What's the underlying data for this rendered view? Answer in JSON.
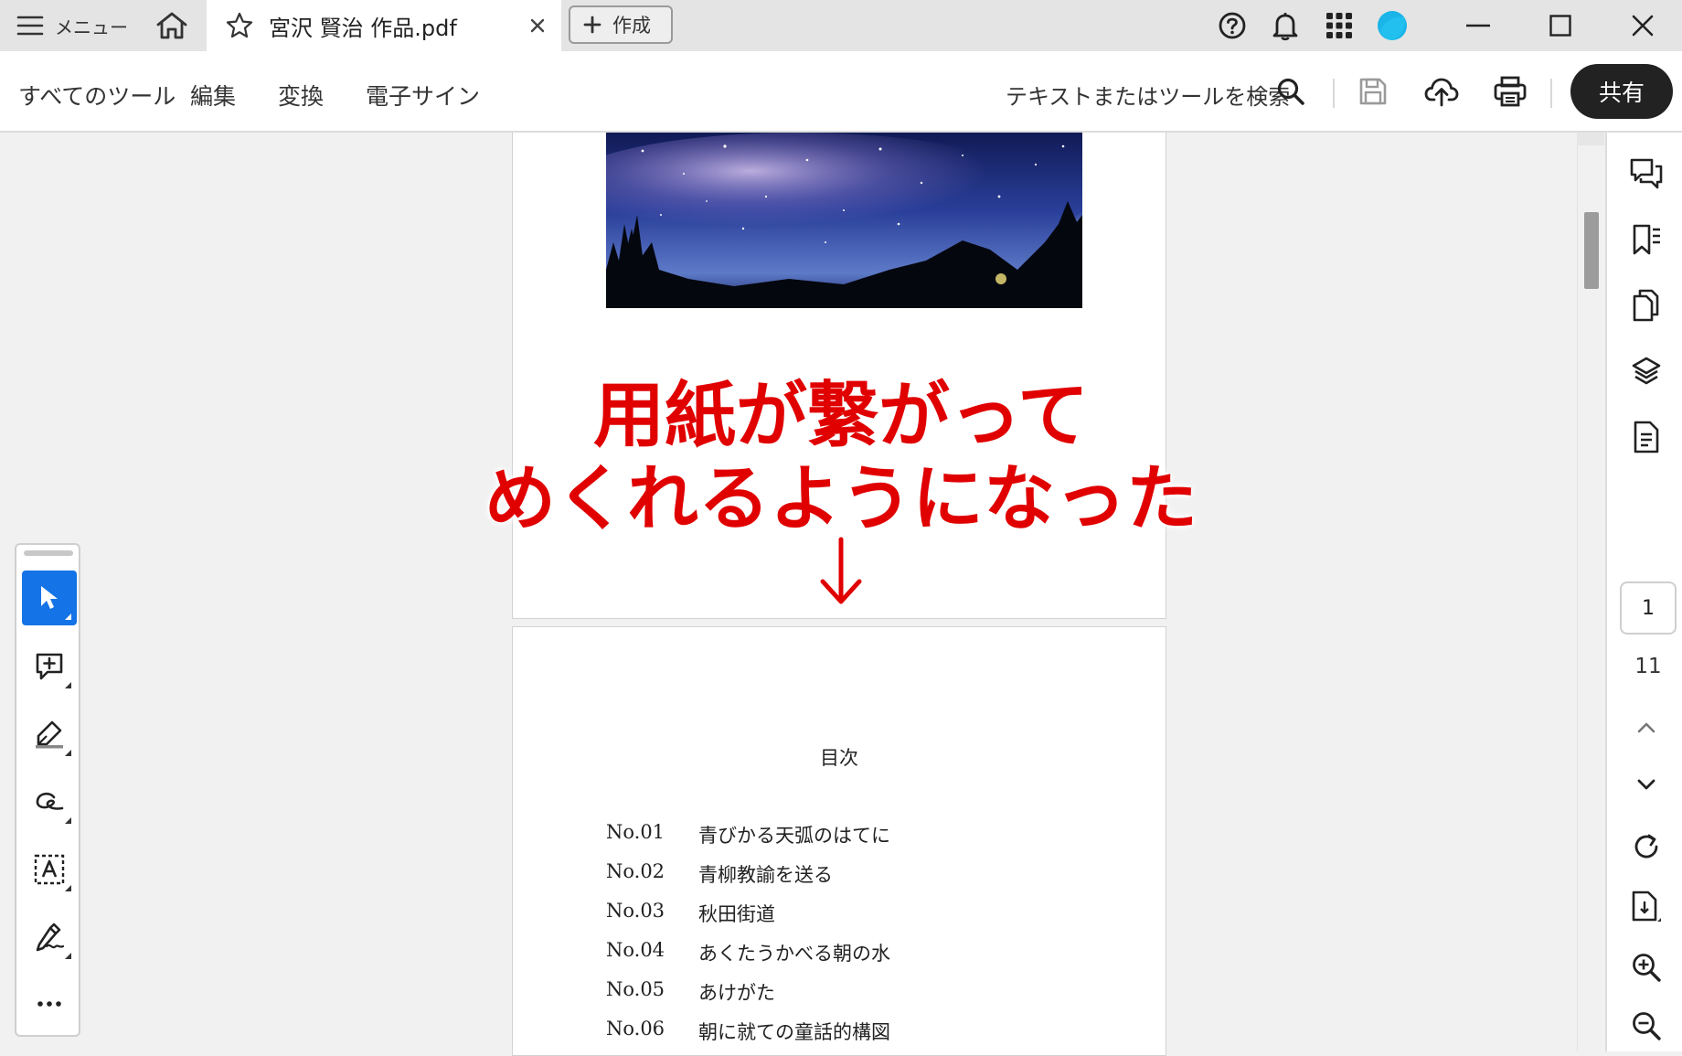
{
  "titlebar": {
    "menu_label": "メニュー",
    "tab_title": "宮沢 賢治 作品.pdf",
    "create_label": "作成",
    "avatar_color": "#1ab4e8"
  },
  "toolbar": {
    "items": [
      "すべてのツール",
      "編集",
      "変換",
      "電子サイン"
    ],
    "search_text": "テキストまたはツールを検索",
    "share_label": "共有"
  },
  "annotation": {
    "line1": "用紙が繋がって",
    "line2": "めくれるようになった",
    "color": "#e00000"
  },
  "toc": {
    "title": "目次",
    "rows": [
      {
        "no": "No.01",
        "title": "青びかる天弧のはてに"
      },
      {
        "no": "No.02",
        "title": "青柳教諭を送る"
      },
      {
        "no": "No.03",
        "title": "秋田街道"
      },
      {
        "no": "No.04",
        "title": "あくたうかべる朝の水"
      },
      {
        "no": "No.05",
        "title": "あけがた"
      },
      {
        "no": "No.06",
        "title": "朝に就ての童話的構図"
      }
    ]
  },
  "page_nav": {
    "current": "1",
    "total": "11"
  },
  "colors": {
    "accent": "#1473e6",
    "share_bg": "#222222"
  }
}
